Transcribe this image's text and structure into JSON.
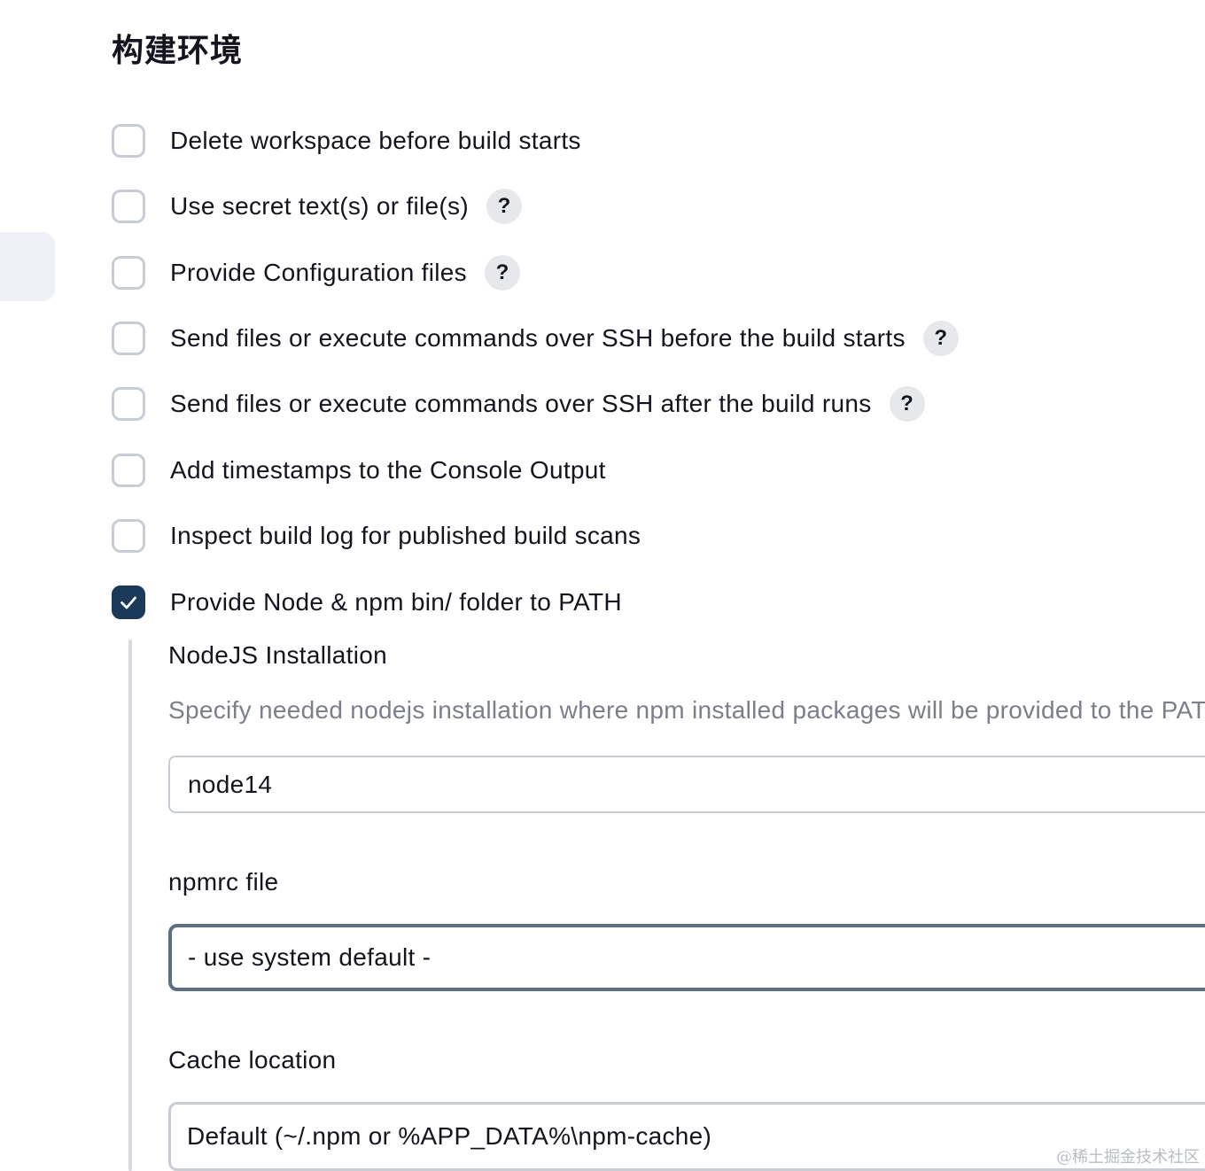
{
  "section_title": "构建环境",
  "options": [
    {
      "label": "Delete workspace before build starts",
      "checked": false,
      "help": false
    },
    {
      "label": "Use secret text(s) or file(s)",
      "checked": false,
      "help": true
    },
    {
      "label": "Provide Configuration files",
      "checked": false,
      "help": true
    },
    {
      "label": "Send files or execute commands over SSH before the build starts",
      "checked": false,
      "help": true
    },
    {
      "label": "Send files or execute commands over SSH after the build runs",
      "checked": false,
      "help": true
    },
    {
      "label": "Add timestamps to the Console Output",
      "checked": false,
      "help": false
    },
    {
      "label": "Inspect build log for published build scans",
      "checked": false,
      "help": false
    },
    {
      "label": "Provide Node & npm bin/ folder to PATH",
      "checked": true,
      "help": false
    }
  ],
  "help_glyph": "?",
  "nodejs": {
    "label": "NodeJS Installation",
    "description": "Specify needed nodejs installation where npm installed packages will be provided to the PATH",
    "value": "node14"
  },
  "npmrc": {
    "label": "npmrc file",
    "selected": "- use system default -"
  },
  "cache": {
    "label": "Cache location",
    "selected": "Default (~/.npm or %APP_DATA%\\npm-cache)"
  },
  "watermark": "@稀土掘金技术社区",
  "colors": {
    "checkbox_checked": "#1b3a5b",
    "checkbox_border": "#c8ccd4",
    "help_bg": "#e7e8ec",
    "description_text": "#7b7f89",
    "select_border": "#5c6f84"
  }
}
